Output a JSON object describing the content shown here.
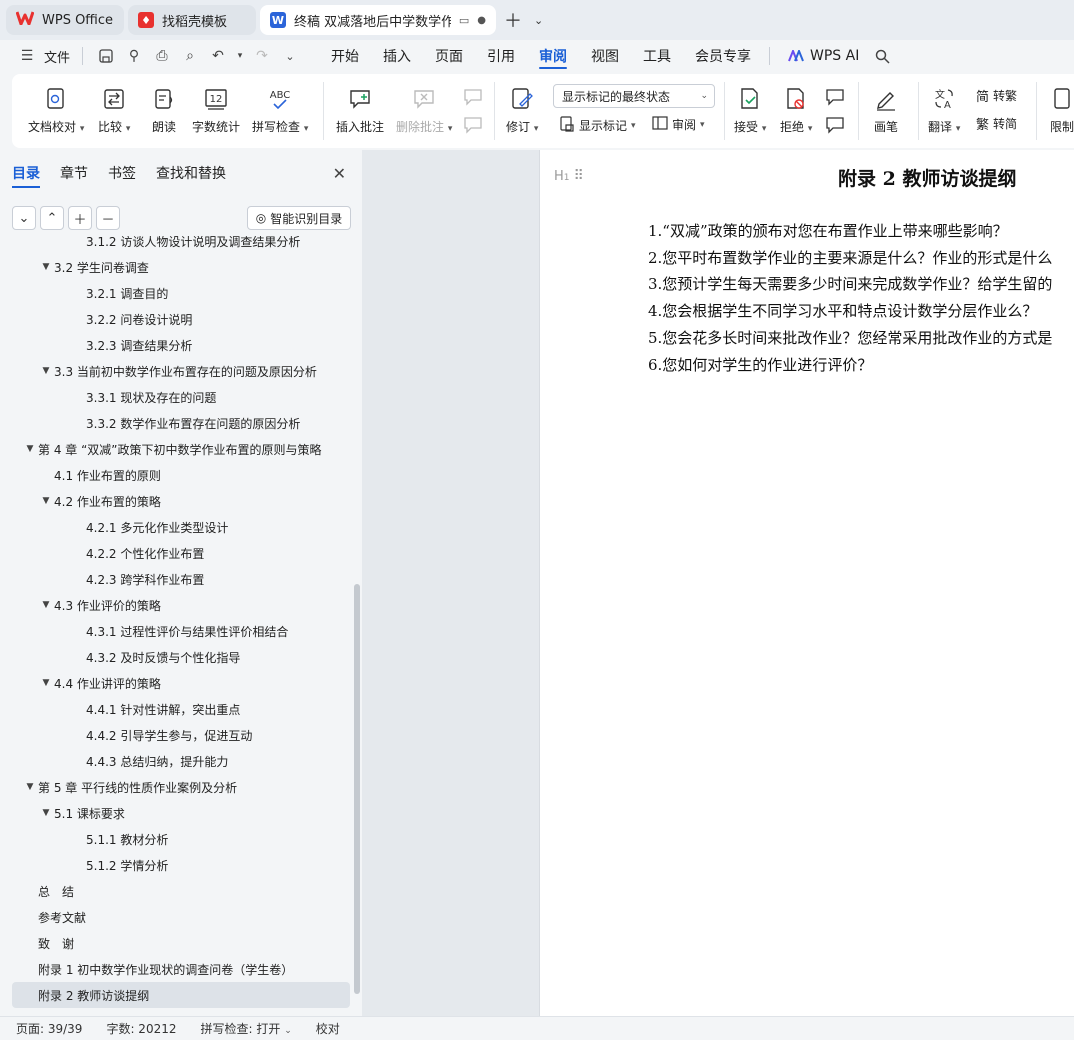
{
  "tabs": [
    {
      "label": "WPS Office",
      "icon": "wps-logo-icon"
    },
    {
      "label": "找稻壳模板",
      "icon": "docer-icon"
    },
    {
      "label": "终稿 双减落地后中学数学作业",
      "icon": "writer-icon"
    }
  ],
  "menu": {
    "file": "文件",
    "items": [
      "开始",
      "插入",
      "页面",
      "引用",
      "审阅",
      "视图",
      "工具",
      "会员专享"
    ],
    "active": "审阅",
    "wps_ai": "WPS AI"
  },
  "ribbon": {
    "doc_check": "文档校对",
    "compare": "比较",
    "read_aloud": "朗读",
    "word_count": "字数统计",
    "spell_check": "拼写检查",
    "insert_comment": "插入批注",
    "delete_comment": "删除批注",
    "revise": "修订",
    "markup_state": "显示标记的最终状态",
    "show_markup": "显示标记",
    "review": "审阅",
    "accept": "接受",
    "reject": "拒绝",
    "pen": "画笔",
    "translate": "翻译",
    "to_traditional": "转繁",
    "to_simplified": "转简",
    "restrict": "限制",
    "spell_icon_text": "ABC",
    "count_icon_text": "12"
  },
  "sidebar": {
    "tabs": [
      "目录",
      "章节",
      "书签",
      "查找和替换"
    ],
    "smart_toc": "智能识别目录",
    "toc": [
      {
        "text": "3.1.2 访谈人物设计说明及调查结果分析",
        "level": 3,
        "arrow": ""
      },
      {
        "text": "3.2 学生问卷调查",
        "level": 2,
        "arrow": "▼"
      },
      {
        "text": "3.2.1 调查目的",
        "level": 3,
        "arrow": ""
      },
      {
        "text": "3.2.2 问卷设计说明",
        "level": 3,
        "arrow": ""
      },
      {
        "text": "3.2.3 调查结果分析",
        "level": 3,
        "arrow": ""
      },
      {
        "text": "3.3 当前初中数学作业布置存在的问题及原因分析",
        "level": 2,
        "arrow": "▼"
      },
      {
        "text": "3.3.1 现状及存在的问题",
        "level": 3,
        "arrow": ""
      },
      {
        "text": "3.3.2 数学作业布置存在问题的原因分析",
        "level": 3,
        "arrow": ""
      },
      {
        "text": "第 4 章 “双减”政策下初中数学作业布置的原则与策略",
        "level": 1,
        "arrow": "▼"
      },
      {
        "text": "4.1 作业布置的原则",
        "level": 2,
        "arrow": ""
      },
      {
        "text": "4.2 作业布置的策略",
        "level": 2,
        "arrow": "▼"
      },
      {
        "text": "4.2.1 多元化作业类型设计",
        "level": 3,
        "arrow": ""
      },
      {
        "text": "4.2.2 个性化作业布置",
        "level": 3,
        "arrow": ""
      },
      {
        "text": "4.2.3 跨学科作业布置",
        "level": 3,
        "arrow": ""
      },
      {
        "text": "4.3 作业评价的策略",
        "level": 2,
        "arrow": "▼"
      },
      {
        "text": "4.3.1 过程性评价与结果性评价相结合",
        "level": 3,
        "arrow": ""
      },
      {
        "text": "4.3.2 及时反馈与个性化指导",
        "level": 3,
        "arrow": ""
      },
      {
        "text": "4.4 作业讲评的策略",
        "level": 2,
        "arrow": "▼"
      },
      {
        "text": "4.4.1 针对性讲解，突出重点",
        "level": 3,
        "arrow": ""
      },
      {
        "text": "4.4.2 引导学生参与，促进互动",
        "level": 3,
        "arrow": ""
      },
      {
        "text": "4.4.3 总结归纳，提升能力",
        "level": 3,
        "arrow": ""
      },
      {
        "text": "第 5 章 平行线的性质作业案例及分析",
        "level": 1,
        "arrow": "▼"
      },
      {
        "text": "5.1 课标要求",
        "level": 2,
        "arrow": "▼"
      },
      {
        "text": "5.1.1 教材分析",
        "level": 3,
        "arrow": ""
      },
      {
        "text": "5.1.2 学情分析",
        "level": 3,
        "arrow": ""
      },
      {
        "text": "总　结",
        "level": 1,
        "arrow": ""
      },
      {
        "text": "参考文献",
        "level": 1,
        "arrow": ""
      },
      {
        "text": "致　谢",
        "level": 1,
        "arrow": ""
      },
      {
        "text": "附录 1 初中数学作业现状的调查问卷（学生卷）",
        "level": 1,
        "arrow": ""
      },
      {
        "text": "附录 2 教师访谈提纲",
        "level": 1,
        "arrow": "",
        "selected": true
      }
    ]
  },
  "document": {
    "heading_marker": "H",
    "title": "附录 2  教师访谈提纲",
    "questions": [
      "1.“双减”政策的颁布对您在布置作业上带来哪些影响？",
      "2.您平时布置数学作业的主要来源是什么？作业的形式是什么",
      "3.您预计学生每天需要多少时间来完成数学作业？给学生留的",
      "4.您会根据学生不同学习水平和特点设计数学分层作业么？",
      "5.您会花多长时间来批改作业？您经常采用批改作业的方式是",
      "6.您如何对学生的作业进行评价？"
    ]
  },
  "status": {
    "page": "页面: 39/39",
    "words": "字数: 20212",
    "spell": "拼写检查: 打开",
    "proof": "校对"
  },
  "colors": {
    "accent": "#1a5fd6",
    "wps_red": "#e8312f",
    "writer_blue": "#2b64d9"
  }
}
